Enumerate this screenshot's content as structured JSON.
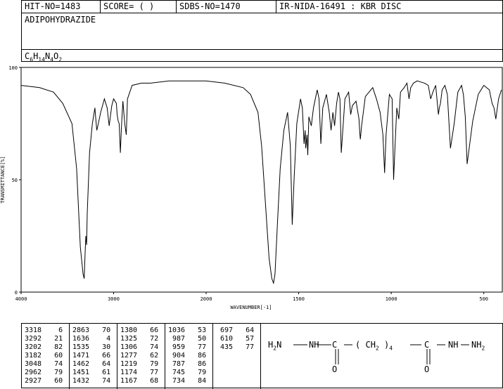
{
  "header": {
    "hit_no": "HIT-NO=1483",
    "score": "SCORE=  (   )",
    "sdbs_no": "SDBS-NO=1470",
    "ir_info": "IR-NIDA-16491 : KBR DISC",
    "compound": "ADIPOHYDRAZIDE",
    "formula_prefix": "C",
    "formula_c": "6",
    "formula_h_label": "H",
    "formula_h": "14",
    "formula_n_label": "N",
    "formula_n": "4",
    "formula_o_label": "O",
    "formula_o": "2"
  },
  "chart_data": {
    "type": "line",
    "xlabel": "WAVENUMBER[-1]",
    "ylabel": "TRANSMITTANCE[%]",
    "xlim": [
      4000,
      400
    ],
    "ylim": [
      0,
      100
    ],
    "x_ticks": [
      "4000",
      "3000",
      "2000",
      "1500",
      "1000",
      "500"
    ],
    "y_ticks": [
      "0",
      "50",
      "100"
    ],
    "grid": false,
    "series": [
      {
        "x": [
          4000,
          3800,
          3650,
          3550,
          3450,
          3400,
          3360,
          3330,
          3318,
          3310,
          3300,
          3292,
          3285,
          3260,
          3230,
          3210,
          3202,
          3195,
          3182,
          3170,
          3140,
          3100,
          3070,
          3048,
          3020,
          3000,
          2970,
          2962,
          2950,
          2940,
          2927,
          2915,
          2900,
          2880,
          2863,
          2850,
          2800,
          2700,
          2600,
          2400,
          2200,
          2000,
          1900,
          1800,
          1760,
          1720,
          1700,
          1680,
          1660,
          1645,
          1636,
          1628,
          1615,
          1600,
          1580,
          1560,
          1545,
          1535,
          1525,
          1510,
          1490,
          1480,
          1471,
          1465,
          1462,
          1455,
          1451,
          1445,
          1432,
          1420,
          1400,
          1390,
          1380,
          1370,
          1350,
          1335,
          1325,
          1315,
          1306,
          1295,
          1285,
          1277,
          1270,
          1250,
          1230,
          1219,
          1210,
          1190,
          1174,
          1170,
          1167,
          1160,
          1140,
          1100,
          1080,
          1060,
          1045,
          1036,
          1028,
          1010,
          995,
          987,
          980,
          970,
          959,
          950,
          930,
          915,
          904,
          895,
          880,
          860,
          820,
          800,
          787,
          775,
          760,
          745,
          740,
          734,
          725,
          710,
          697,
          680,
          660,
          640,
          620,
          610,
          600,
          590,
          560,
          530,
          500,
          470,
          455,
          445,
          435,
          420,
          405
        ],
        "y": [
          92,
          91,
          89,
          84,
          75,
          55,
          20,
          8,
          6,
          15,
          25,
          21,
          35,
          62,
          75,
          80,
          82,
          78,
          72,
          74,
          80,
          86,
          82,
          74,
          83,
          86,
          84,
          79,
          76,
          75,
          62,
          74,
          85,
          75,
          70,
          86,
          92,
          93,
          93,
          94,
          94,
          94,
          93,
          91,
          88,
          80,
          65,
          40,
          15,
          6,
          4,
          8,
          30,
          55,
          72,
          80,
          65,
          30,
          50,
          75,
          86,
          82,
          66,
          72,
          64,
          70,
          61,
          78,
          74,
          82,
          90,
          86,
          66,
          82,
          88,
          80,
          72,
          80,
          74,
          84,
          89,
          86,
          62,
          86,
          89,
          79,
          83,
          85,
          77,
          71,
          68,
          74,
          87,
          91,
          86,
          80,
          70,
          53,
          70,
          88,
          86,
          50,
          64,
          82,
          77,
          89,
          91,
          93,
          86,
          91,
          93,
          94,
          93,
          92,
          86,
          89,
          92,
          79,
          82,
          84,
          90,
          92,
          88,
          64,
          75,
          89,
          92,
          88,
          78,
          57,
          76,
          88,
          92,
          90,
          84,
          82,
          77,
          86,
          90
        ]
      }
    ]
  },
  "peaks": [
    [
      "3318",
      "6",
      "3292",
      "21",
      "3202",
      "82",
      "3182",
      "60",
      "3048",
      "74",
      "2962",
      "79",
      "2927",
      "60"
    ],
    [
      "2863",
      "70",
      "1636",
      "4",
      "1535",
      "30",
      "1471",
      "66",
      "1462",
      "64",
      "1451",
      "61",
      "1432",
      "74"
    ],
    [
      "1380",
      "66",
      "1325",
      "72",
      "1306",
      "74",
      "1277",
      "62",
      "1219",
      "79",
      "1174",
      "77",
      "1167",
      "68"
    ],
    [
      "1036",
      "53",
      "987",
      "50",
      "959",
      "77",
      "904",
      "86",
      "787",
      "86",
      "745",
      "79",
      "734",
      "84"
    ],
    [
      "697",
      "64",
      "610",
      "57",
      "435",
      "77"
    ]
  ],
  "structure": {
    "h2n": "H",
    "h2n_sub": "2",
    "n1": "N",
    "nh1": "NH",
    "c1": "C",
    "paren_open": "(",
    "ch2": "CH",
    "ch2_sub": "2",
    "paren_close": ")",
    "n_sub": "4",
    "c2": "C",
    "nh2": "NH",
    "n2": "NH",
    "n2_sub": "2",
    "o1": "O",
    "o2": "O"
  }
}
